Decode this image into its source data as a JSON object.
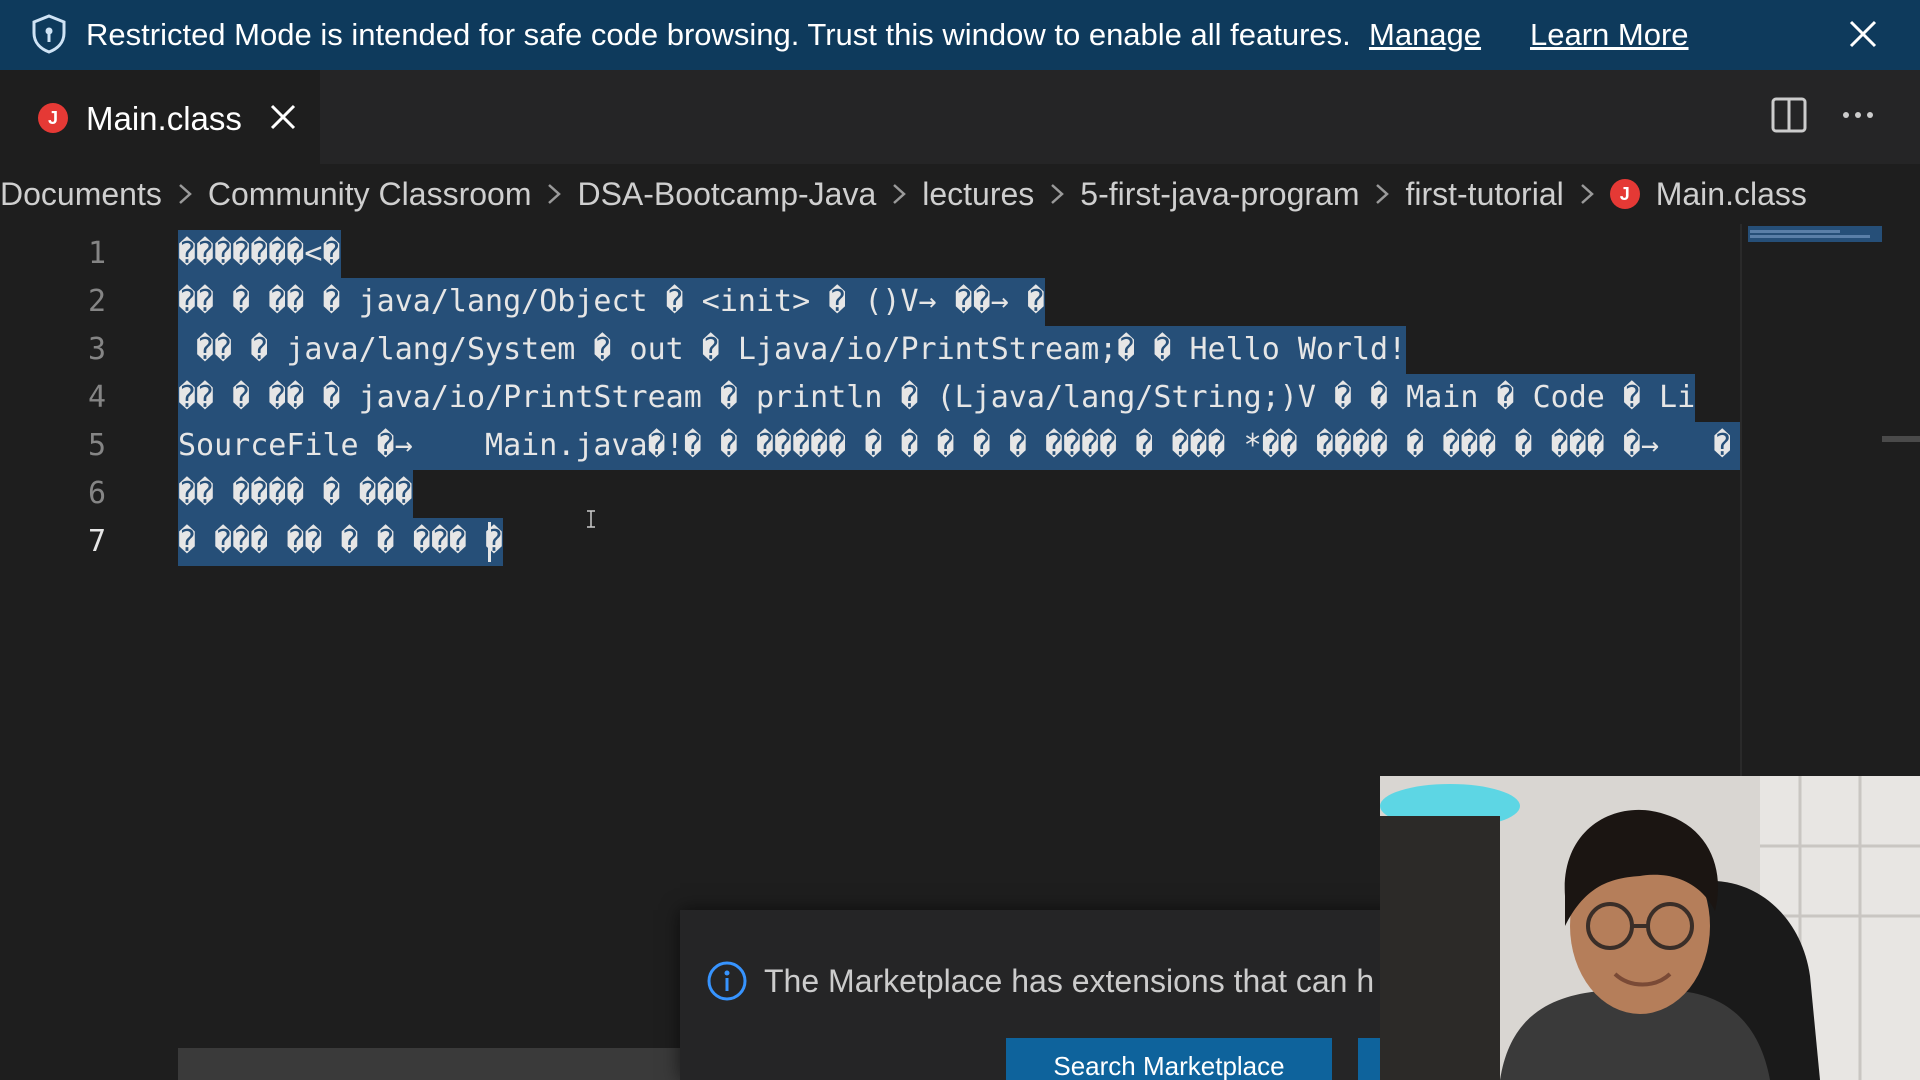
{
  "banner": {
    "message": "Restricted Mode is intended for safe code browsing. Trust this window to enable all features.",
    "manage": "Manage",
    "learn_more": "Learn More"
  },
  "tab": {
    "icon_letter": "J",
    "label": "Main.class"
  },
  "breadcrumb": {
    "items": [
      "Documents",
      "Community Classroom",
      "DSA-Bootcamp-Java",
      "lectures",
      "5-first-java-program",
      "first-tutorial"
    ],
    "file": "Main.class",
    "file_icon_letter": "J"
  },
  "editor": {
    "line_numbers": [
      "1",
      "2",
      "3",
      "4",
      "5",
      "6",
      "7"
    ],
    "active_line": "7",
    "lines": [
      "�������<�",
      "�� � �� � java/lang/Object � <init> � ()V→ ��→ �",
      " �� � java/lang/System � out � Ljava/io/PrintStream;� � Hello World!",
      "�� � �� � java/io/PrintStream � println � (Ljava/lang/String;)V � � Main � Code � Li",
      "SourceFile �→    Main.java�!� � ����� � � � � � ���� � ��� *�� ���� � ��� � ��� �→   � � � �",
      "�� ���� � ���",
      "� ��� �� � � ��� �"
    ]
  },
  "notification": {
    "message": "The Marketplace has extensions that can h",
    "button_primary": "Search Marketplace",
    "button_secondary": ""
  },
  "colors": {
    "banner_bg": "#0e3a5c",
    "selection": "#264f78",
    "java_icon": "#e53935",
    "editor_bg": "#1e1e1e"
  },
  "icons": [
    "shield-icon",
    "close-icon",
    "java-file-icon",
    "split-editor-icon",
    "more-actions-icon",
    "chevron-right-icon",
    "info-icon"
  ]
}
